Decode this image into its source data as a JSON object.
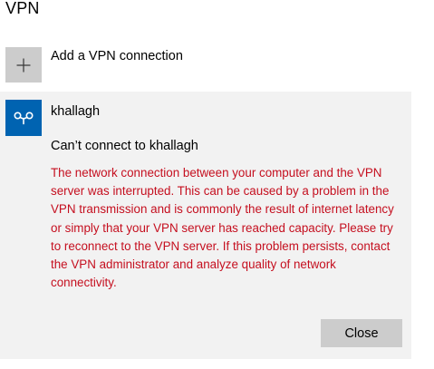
{
  "page": {
    "title": "VPN"
  },
  "add_connection": {
    "icon": "plus-icon",
    "label": "Add a VPN connection"
  },
  "connection": {
    "icon": "vpn-connection-icon",
    "name": "khallagh",
    "status": "Can’t connect to khallagh",
    "error_message": "The network connection between your computer and the VPN server was interrupted.  This can be caused by a problem in the VPN transmission and is commonly the result of internet latency or simply that your VPN server has reached capacity.  Please try to reconnect to the VPN server.  If this problem persists, contact the VPN administrator and analyze quality of network connectivity.",
    "close_label": "Close"
  },
  "colors": {
    "accent": "#0063b1",
    "error_text": "#c50f1f",
    "tile_gray": "#cccccc",
    "panel_bg": "#f2f2f2"
  }
}
